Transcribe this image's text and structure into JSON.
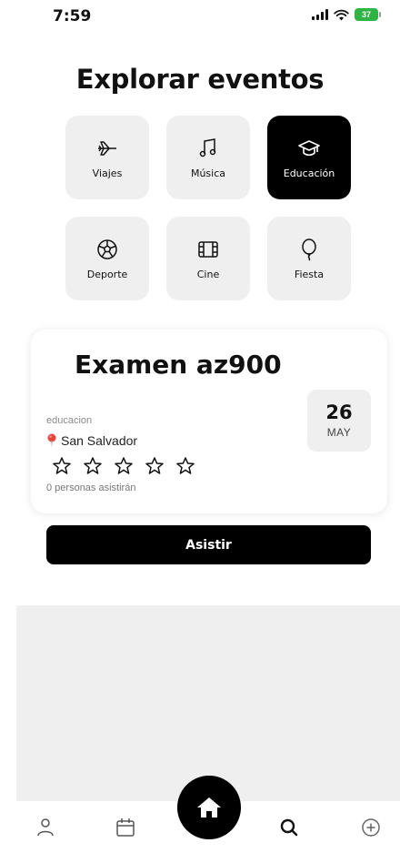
{
  "status_bar": {
    "time": "7:59",
    "battery": "37"
  },
  "title": "Explorar eventos",
  "categories": [
    {
      "label": "Viajes",
      "icon": "airplane-icon",
      "active": false
    },
    {
      "label": "Música",
      "icon": "music-note-icon",
      "active": false
    },
    {
      "label": "Educación",
      "icon": "graduation-cap-icon",
      "active": true
    },
    {
      "label": "Deporte",
      "icon": "soccer-ball-icon",
      "active": false
    },
    {
      "label": "Cine",
      "icon": "film-icon",
      "active": false
    },
    {
      "label": "Fiesta",
      "icon": "balloon-icon",
      "active": false
    }
  ],
  "event": {
    "title": "Examen az900",
    "category": "educacion",
    "location": "San Salvador",
    "rating": 0,
    "rating_max": 5,
    "attendees": "0 personas asistirán",
    "date_day": "26",
    "date_month": "MAY"
  },
  "attend_button": "Asistir",
  "tab_bar": {
    "items": [
      "profile-icon",
      "calendar-icon",
      "home-icon",
      "search-icon",
      "add-circle-icon"
    ],
    "active": "home-icon"
  },
  "colors": {
    "accent": "#000000",
    "tile_bg": "#efefef",
    "pin": "#e8453c",
    "battery": "#2fb344"
  }
}
